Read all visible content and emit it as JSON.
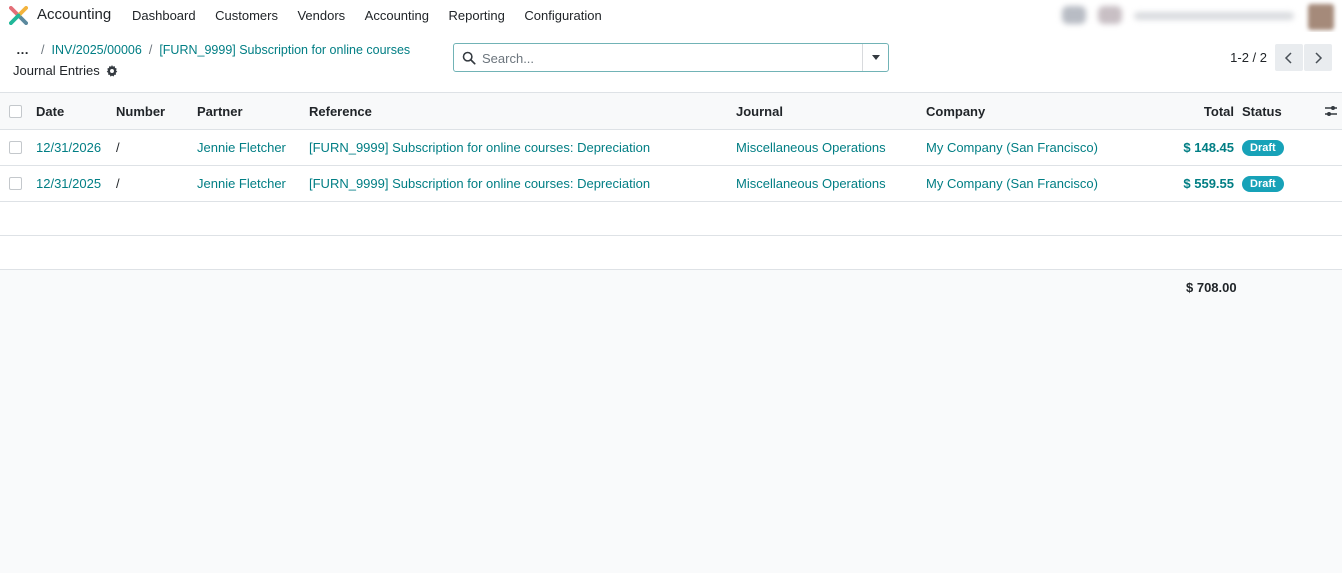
{
  "app": {
    "name": "Accounting",
    "logo_colors": [
      "#e46f78",
      "#f3b33d",
      "#21b799",
      "#5b899e"
    ]
  },
  "nav": {
    "items": [
      {
        "label": "Dashboard"
      },
      {
        "label": "Customers"
      },
      {
        "label": "Vendors"
      },
      {
        "label": "Accounting"
      },
      {
        "label": "Reporting"
      },
      {
        "label": "Configuration"
      }
    ]
  },
  "breadcrumb": {
    "dots": "…",
    "items": [
      {
        "label": "INV/2025/00006"
      },
      {
        "label": "[FURN_9999] Subscription for online courses"
      }
    ],
    "separator": "/"
  },
  "view": {
    "title": "Journal Entries"
  },
  "search": {
    "placeholder": "Search...",
    "value": ""
  },
  "pager": {
    "value": "1-2 / 2"
  },
  "table": {
    "columns": {
      "date": "Date",
      "number": "Number",
      "partner": "Partner",
      "reference": "Reference",
      "journal": "Journal",
      "company": "Company",
      "total": "Total",
      "status": "Status"
    },
    "rows": [
      {
        "date": "12/31/2026",
        "number": "/",
        "partner": "Jennie Fletcher",
        "reference": "[FURN_9999] Subscription for online courses: Depreciation",
        "journal": "Miscellaneous Operations",
        "company": "My Company (San Francisco)",
        "total": "$ 148.45",
        "status": "Draft"
      },
      {
        "date": "12/31/2025",
        "number": "/",
        "partner": "Jennie Fletcher",
        "reference": "[FURN_9999] Subscription for online courses: Depreciation",
        "journal": "Miscellaneous Operations",
        "company": "My Company (San Francisco)",
        "total": "$ 559.55",
        "status": "Draft"
      }
    ],
    "grand_total": "$ 708.00"
  },
  "colors": {
    "accent": "#017e84",
    "badge": "#17a2b8"
  }
}
